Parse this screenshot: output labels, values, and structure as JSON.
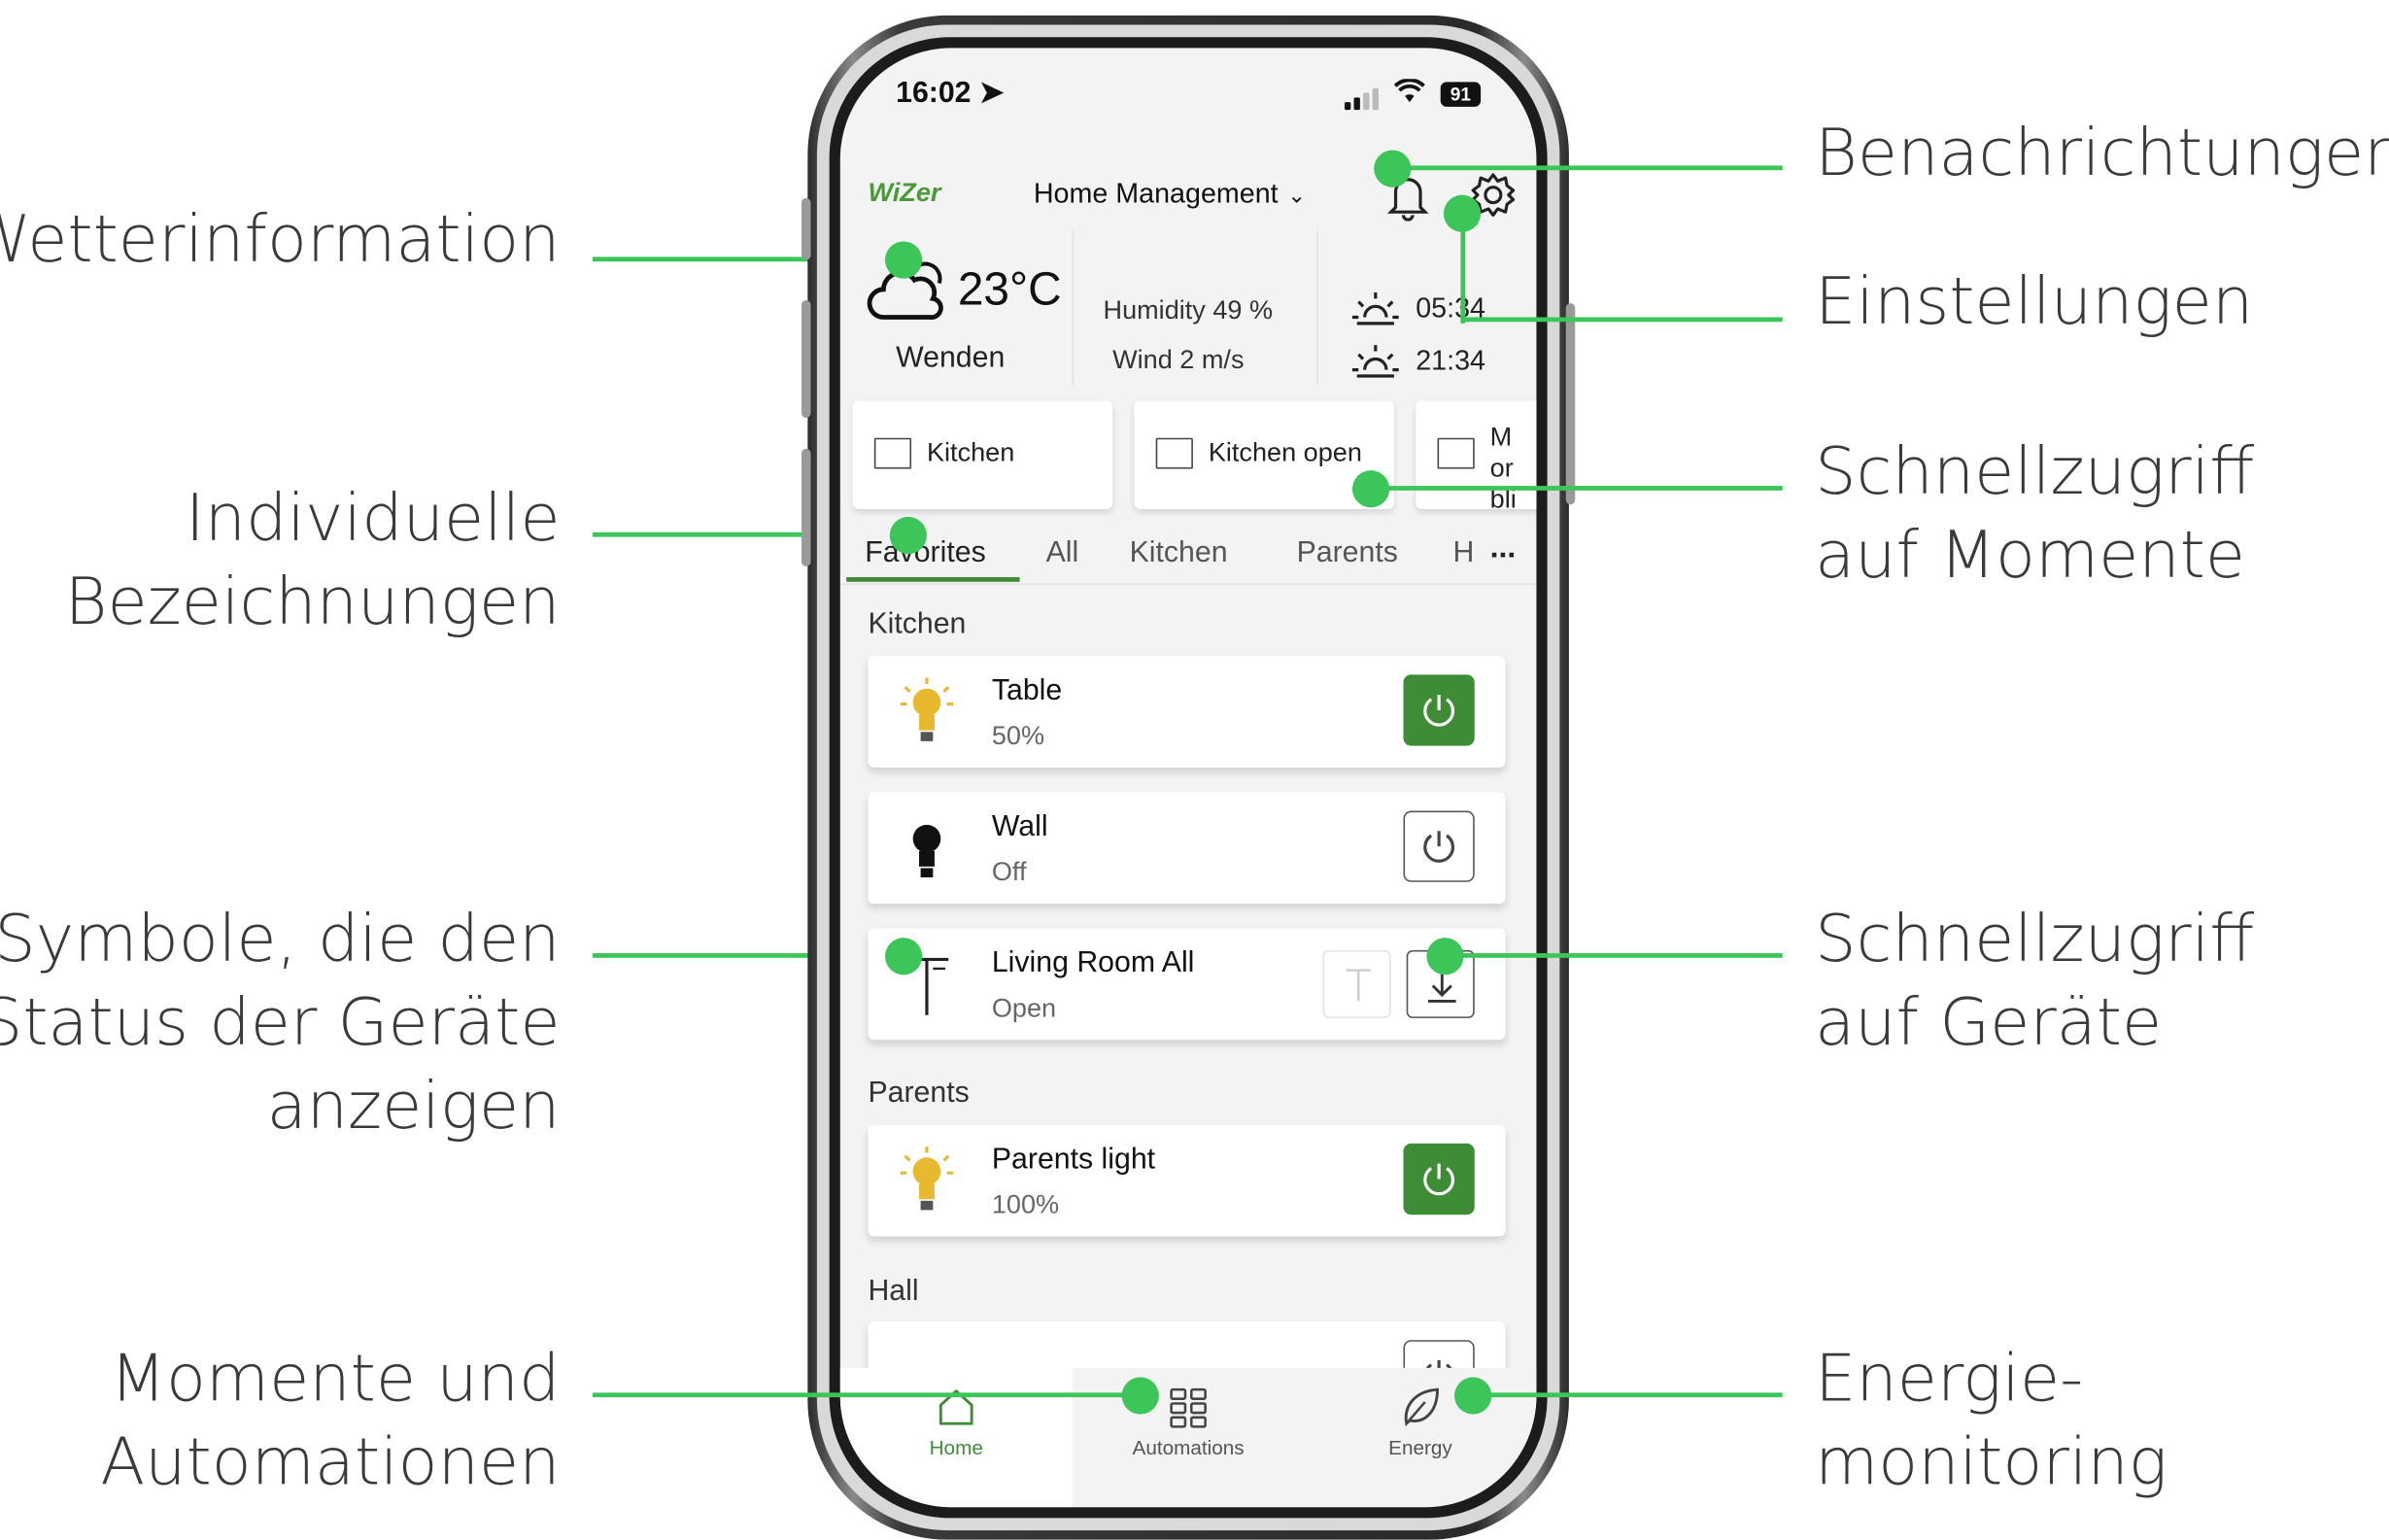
{
  "phone": {
    "status": {
      "time": "16:02 ➤",
      "battery": "91"
    },
    "header": {
      "logo": "WiZer",
      "home_selector": "Home Management"
    },
    "weather": {
      "temperature": "23°C",
      "location": "Wenden",
      "humidity": "Humidity 49 %",
      "wind": "Wind 2 m/s",
      "sunrise": "05:34",
      "sunset": "21:34"
    },
    "moments": [
      {
        "label": "Kitchen"
      },
      {
        "label": "Kitchen open"
      },
      {
        "label": "Mor blin"
      }
    ],
    "tabs": [
      "Favorites",
      "All",
      "Kitchen",
      "Parents",
      "H"
    ],
    "tabs_more": "...",
    "sections": [
      {
        "title": "Kitchen",
        "devices": [
          {
            "name": "Table",
            "value": "50%",
            "type": "light",
            "state": "on"
          },
          {
            "name": "Wall",
            "value": "Off",
            "type": "light",
            "state": "off"
          },
          {
            "name": "Living Room All",
            "value": "Open",
            "type": "blind",
            "state": "open"
          }
        ]
      },
      {
        "title": "Parents",
        "devices": [
          {
            "name": "Parents light",
            "value": "100%",
            "type": "light",
            "state": "on"
          }
        ]
      },
      {
        "title": "Hall",
        "devices": [
          {
            "name": "",
            "value": "",
            "type": "light",
            "state": "off"
          }
        ]
      }
    ],
    "nav": [
      {
        "label": "Home",
        "icon": "home-icon",
        "active": true
      },
      {
        "label": "Automations",
        "icon": "grid-icon",
        "active": false
      },
      {
        "label": "Energy",
        "icon": "leaf-icon",
        "active": false
      }
    ],
    "colors": {
      "accent_green": "#3e8c36",
      "callout_green": "#3cc65a"
    }
  },
  "annotations": {
    "weather_info": "Wetterinformation",
    "custom_names": [
      "Individuelle",
      "Bezeichnungen"
    ],
    "status_symbols": [
      "Symbole, die den",
      "Status der Geräte",
      "anzeigen"
    ],
    "moments_automations": [
      "Momente und",
      "Automationen"
    ],
    "notifications": "Benachrichtungen",
    "settings": "Einstellungen",
    "quick_moments": [
      "Schnellzugriff",
      "auf Momente"
    ],
    "quick_devices": [
      "Schnellzugriff",
      "auf Geräte"
    ],
    "energy": [
      "Energie-",
      "monitoring"
    ]
  }
}
